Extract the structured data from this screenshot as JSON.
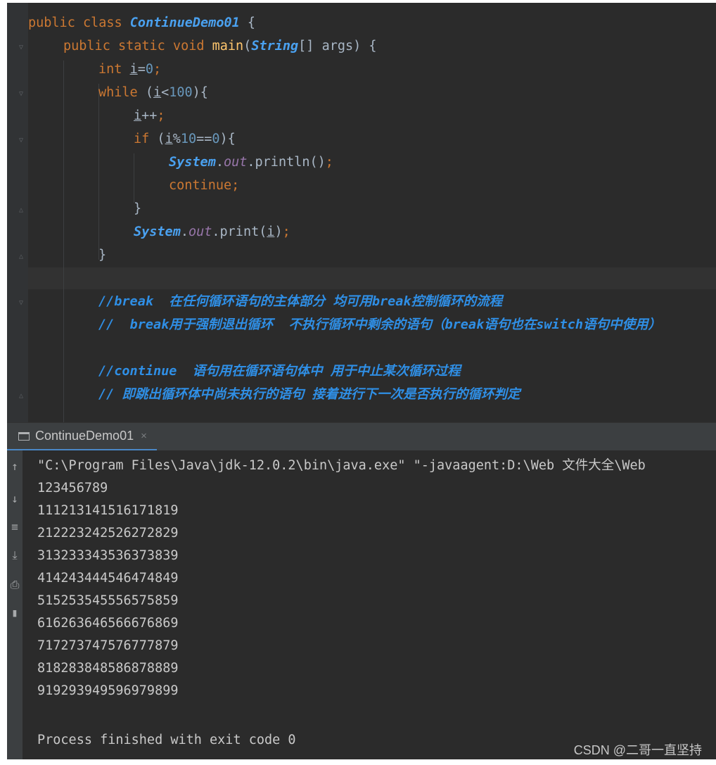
{
  "editor": {
    "line1": {
      "kw": "public class ",
      "cls": "ContinueDemo01",
      "rest": " {"
    },
    "line2": {
      "kw": "public static void ",
      "fn": "main",
      "p1": "(",
      "cls": "String",
      "p2": "[] args) {"
    },
    "line3": {
      "kw": "int ",
      "var": "i",
      "eq": "=",
      "num": "0",
      "semi": ";"
    },
    "line4": {
      "kw": "while ",
      "p1": "(",
      "var": "i",
      "op": "<",
      "num": "100",
      "p2": "){"
    },
    "line5": {
      "var": "i",
      "op": "++",
      "semi": ";"
    },
    "line6": {
      "kw": "if ",
      "p1": "(",
      "var": "i",
      "op": "%",
      "num": "10",
      "eq": "==",
      "num2": "0",
      "p2": "){"
    },
    "line7": {
      "cls": "System",
      "dot": ".",
      "fld": "out",
      "call": ".println()",
      "semi": ";"
    },
    "line8": {
      "kw": "continue",
      "semi": ";"
    },
    "line9": {
      "brace": "}"
    },
    "line10": {
      "cls": "System",
      "dot": ".",
      "fld": "out",
      "call": ".print(",
      "var": "i",
      "close": ")",
      "semi": ";"
    },
    "line11": {
      "brace": "}"
    },
    "comment1": "//break  在任何循环语句的主体部分 均可用break控制循环的流程",
    "comment2": "//  break用于强制退出循环  不执行循环中剩余的语句（break语句也在switch语句中使用）",
    "comment3": "//continue  语句用在循环语句体中 用于中止某次循环过程",
    "comment4": "// 即跳出循环体中尚未执行的语句 接着进行下一次是否执行的循环判定"
  },
  "run_tab": {
    "label": "ContinueDemo01",
    "close": "×"
  },
  "console": {
    "lines": [
      "\"C:\\Program Files\\Java\\jdk-12.0.2\\bin\\java.exe\" \"-javaagent:D:\\Web 文件大全\\Web",
      "123456789",
      "111213141516171819",
      "212223242526272829",
      "313233343536373839",
      "414243444546474849",
      "515253545556575859",
      "616263646566676869",
      "717273747576777879",
      "818283848586878889",
      "919293949596979899",
      "",
      "Process finished with exit code 0"
    ]
  },
  "watermark": "CSDN @二哥一直坚持",
  "colors": {
    "keyword": "#cc7832",
    "class": "#4aa1f0",
    "method": "#ffc66d",
    "number": "#6897bb",
    "comment": "#2f8fe6",
    "background": "#2b2b2b"
  }
}
